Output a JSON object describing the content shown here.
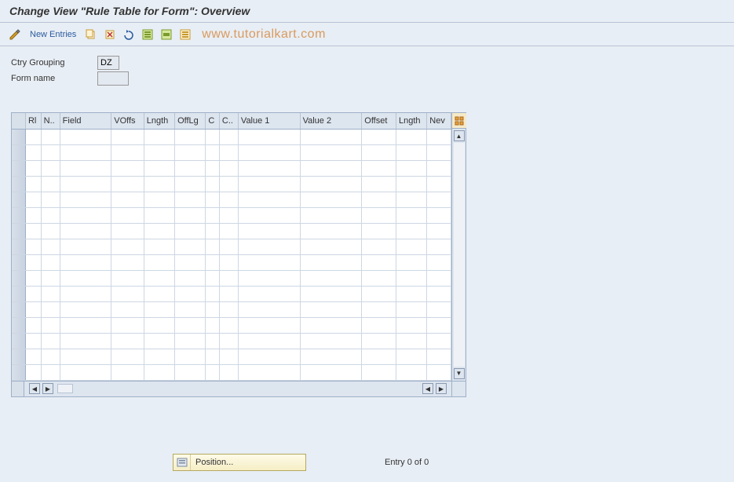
{
  "title": "Change View \"Rule Table for Form\": Overview",
  "toolbar": {
    "new_entries_label": "New Entries"
  },
  "watermark": "www.tutorialkart.com",
  "form": {
    "ctry_grouping_label": "Ctry Grouping",
    "ctry_grouping_value": "DZ",
    "form_name_label": "Form name",
    "form_name_value": ""
  },
  "table": {
    "columns": [
      "Rl",
      "N..",
      "Field",
      "VOffs",
      "Lngth",
      "OffLg",
      "C",
      "C..",
      "Value 1",
      "Value 2",
      "Offset",
      "Lngth",
      "Nev"
    ],
    "rows": [
      [],
      [],
      [],
      [],
      [],
      [],
      [],
      [],
      [],
      [],
      [],
      [],
      [],
      [],
      [],
      []
    ]
  },
  "footer": {
    "position_label": "Position...",
    "entry_text": "Entry 0 of 0"
  }
}
